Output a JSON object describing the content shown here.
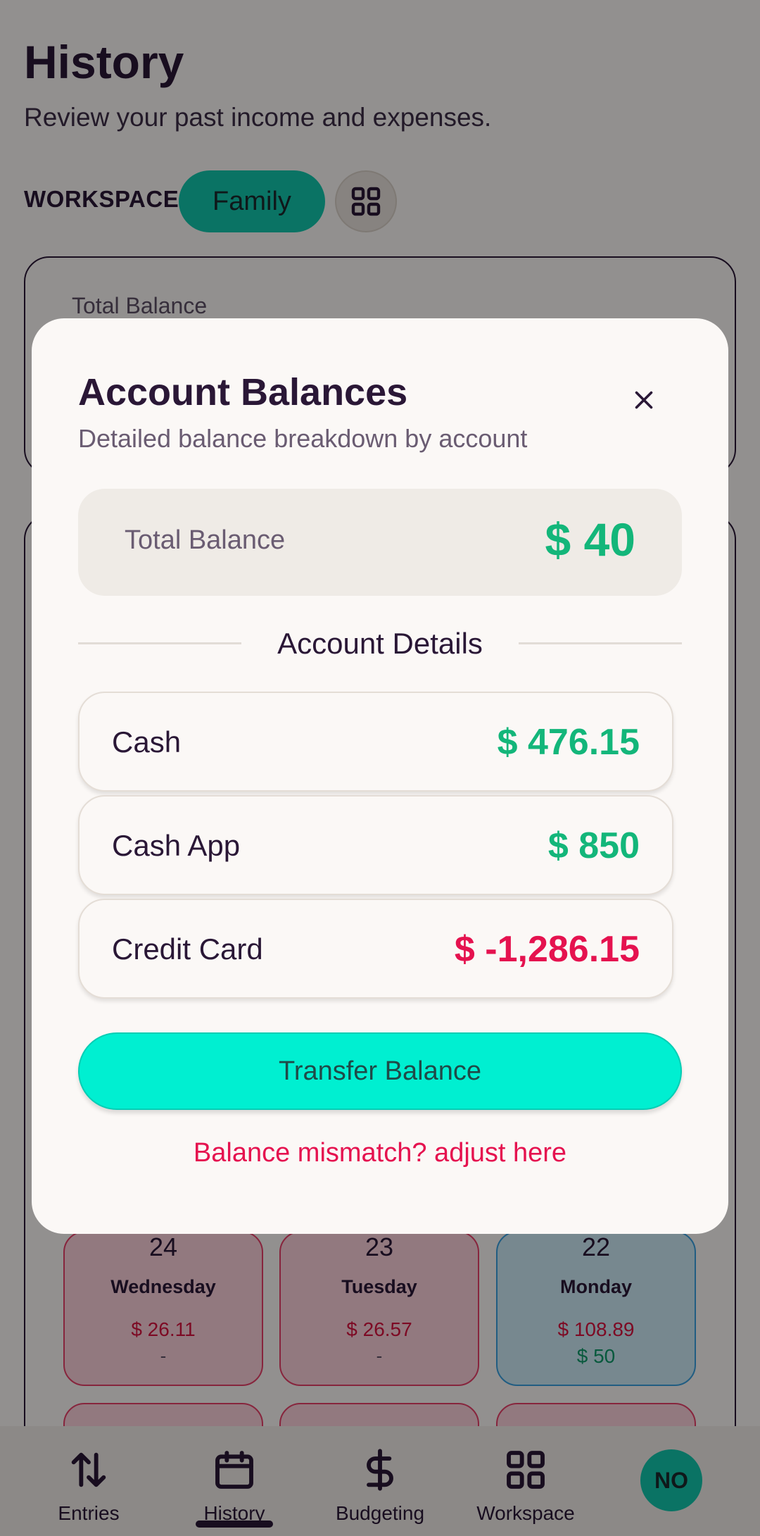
{
  "page": {
    "title": "History",
    "subtitle": "Review your past income and expenses.",
    "workspace_label": "WORKSPACE:",
    "workspace_name": "Family",
    "card_label": "Total Balance"
  },
  "calendar": {
    "days": [
      {
        "num": "24",
        "name": "Wednesday",
        "expense": "$ 26.11",
        "income": "-"
      },
      {
        "num": "23",
        "name": "Tuesday",
        "expense": "$ 26.57",
        "income": "-"
      },
      {
        "num": "22",
        "name": "Monday",
        "expense": "$ 108.89",
        "income": "$ 50"
      }
    ]
  },
  "bottom_nav": {
    "items": [
      {
        "label": "Entries",
        "icon": "arrows-up-down-icon"
      },
      {
        "label": "History",
        "icon": "calendar-icon"
      },
      {
        "label": "Budgeting",
        "icon": "dollar-icon"
      },
      {
        "label": "Workspace",
        "icon": "grid-icon"
      }
    ],
    "avatar": "NO",
    "active": "History"
  },
  "modal": {
    "title": "Account Balances",
    "subtitle": "Detailed balance breakdown by account",
    "total_label": "Total Balance",
    "total_value": "$ 40",
    "section_label": "Account Details",
    "accounts": [
      {
        "name": "Cash",
        "value": "$ 476.15"
      },
      {
        "name": "Cash App",
        "value": "$ 850"
      },
      {
        "name": "Credit Card",
        "value": "$ -1,286.15"
      }
    ],
    "transfer_label": "Transfer Balance",
    "adjust_label": "Balance mismatch? adjust here"
  },
  "colors": {
    "accent": "#12c7ac",
    "positive": "#13b67a",
    "negative": "#e5124f",
    "transfer_button": "#00efd1"
  }
}
